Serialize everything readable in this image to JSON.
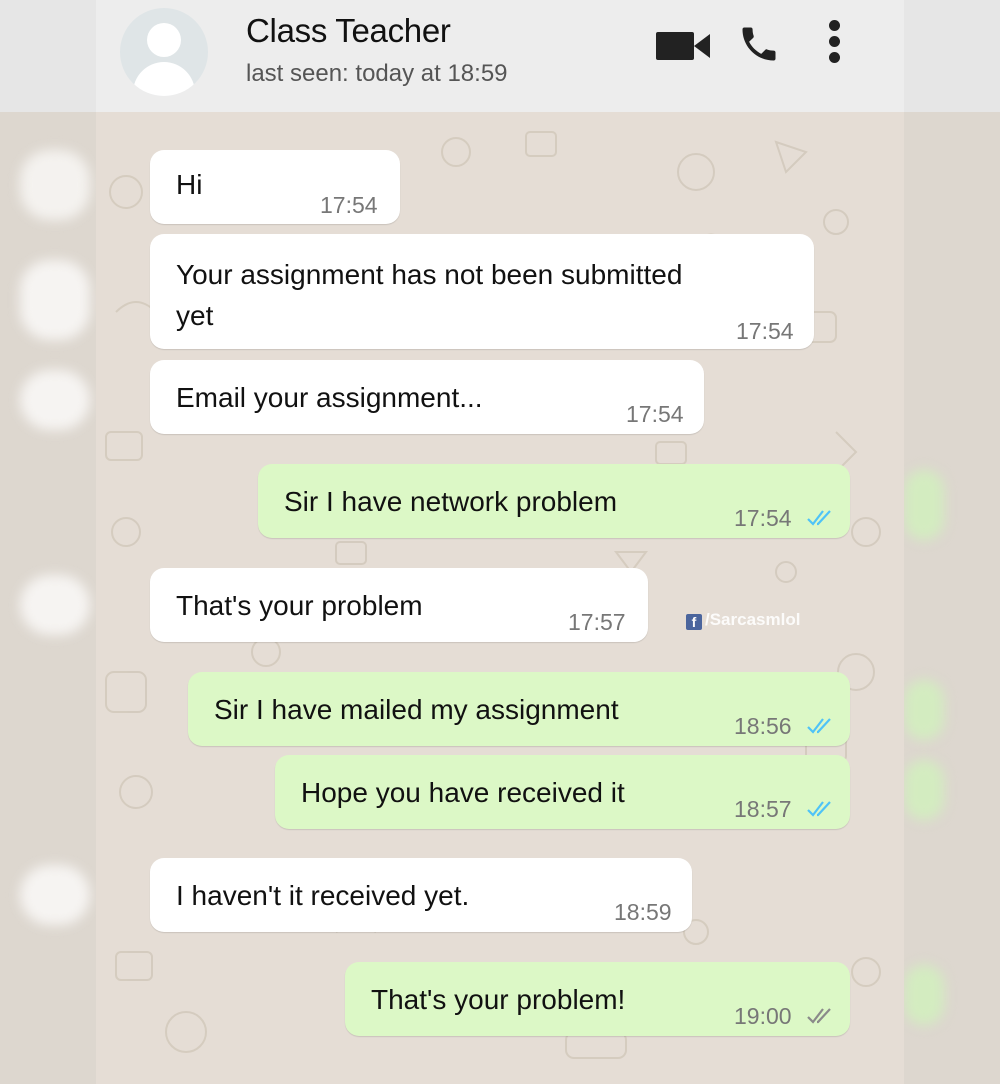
{
  "header": {
    "contact_name": "Class Teacher",
    "last_seen": "last seen: today at 18:59",
    "icons": [
      "video-call-icon",
      "voice-call-icon",
      "more-options-icon"
    ]
  },
  "colors": {
    "header_bg": "#ededed",
    "chat_bg": "#e5ddd5",
    "incoming_bubble": "#ffffff",
    "outgoing_bubble": "#dcf8c6",
    "read_tick": "#4fc3f7",
    "delivered_tick": "#8a8a8a"
  },
  "messages": [
    {
      "direction": "incoming",
      "text": "Hi",
      "time": "17:54"
    },
    {
      "direction": "incoming",
      "text": "Your assignment has not been submitted",
      "text2": "yet",
      "time": "17:54"
    },
    {
      "direction": "incoming",
      "text": "Email your assignment...",
      "time": "17:54"
    },
    {
      "direction": "outgoing",
      "text": "Sir I have network problem",
      "time": "17:54",
      "status": "read"
    },
    {
      "direction": "incoming",
      "text": "That's your problem",
      "time": "17:57"
    },
    {
      "direction": "outgoing",
      "text": "Sir I have mailed my assignment",
      "time": "18:56",
      "status": "read"
    },
    {
      "direction": "outgoing",
      "text": "Hope you have received it",
      "time": "18:57",
      "status": "read"
    },
    {
      "direction": "incoming",
      "text": "I haven't it received yet.",
      "time": "18:59"
    },
    {
      "direction": "outgoing",
      "text": "That's your problem!",
      "time": "19:00",
      "status": "delivered"
    }
  ],
  "watermark": "/Sarcasmlol"
}
